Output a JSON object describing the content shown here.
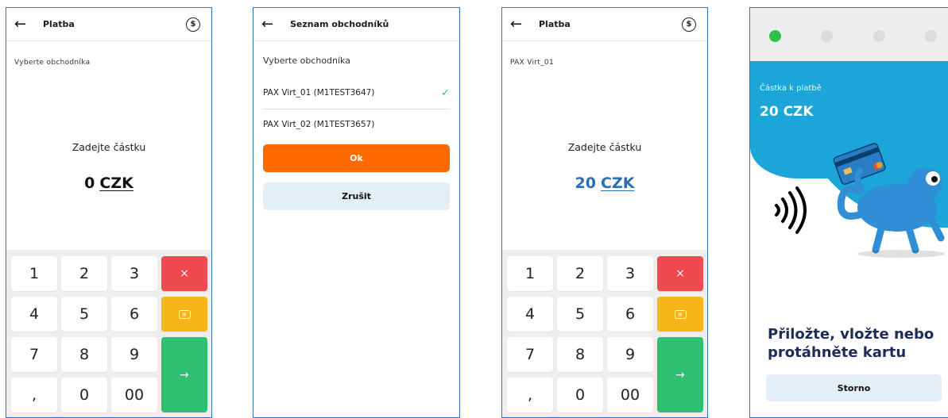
{
  "screen1": {
    "title": "Platba",
    "merchant_label": "Vyberte obchodníka",
    "prompt": "Zadejte částku",
    "amount_value": "0",
    "currency": "CZK",
    "keys": [
      "1",
      "2",
      "3",
      "4",
      "5",
      "6",
      "7",
      "8",
      "9",
      ",",
      "0",
      "00"
    ],
    "clear_symbol": "×",
    "enter_symbol": "→"
  },
  "screen2": {
    "title": "Seznam obchodníků",
    "label": "Vyberte obchodníka",
    "merchants": [
      {
        "name": "PAX Virt_01 (M1TEST3647)",
        "selected": true
      },
      {
        "name": "PAX Virt_02 (M1TEST3657)",
        "selected": false
      }
    ],
    "check_symbol": "✓",
    "ok_label": "Ok",
    "cancel_label": "Zrušit"
  },
  "screen3": {
    "title": "Platba",
    "merchant_label": "PAX Virt_01",
    "prompt": "Zadejte částku",
    "amount_value": "20",
    "currency": "CZK",
    "keys": [
      "1",
      "2",
      "3",
      "4",
      "5",
      "6",
      "7",
      "8",
      "9",
      ",",
      "0",
      "00"
    ],
    "clear_symbol": "×",
    "enter_symbol": "→"
  },
  "screen4": {
    "caption": "Částka k platbě",
    "amount": "20 CZK",
    "message_line1": "Přiložte, vložte nebo",
    "message_line2": "protáhněte kartu",
    "storno_label": "Storno",
    "progress_step_active": 1,
    "progress_steps_total": 4
  },
  "colors": {
    "frame": "#3d6fbf",
    "red": "#ee4a4f",
    "yellow": "#f4b619",
    "green": "#2fbf73",
    "orange": "#ff6a00",
    "light_button": "#e4eef7",
    "blue_amount": "#2b6fb3",
    "hero_blue": "#1ba5d9"
  },
  "icons": {
    "back": "arrow-left-icon",
    "currency_swap": "currency-exchange-icon",
    "backspace": "backspace-icon",
    "enter": "arrow-right-icon",
    "check": "checkmark-icon",
    "contactless": "contactless-icon"
  }
}
